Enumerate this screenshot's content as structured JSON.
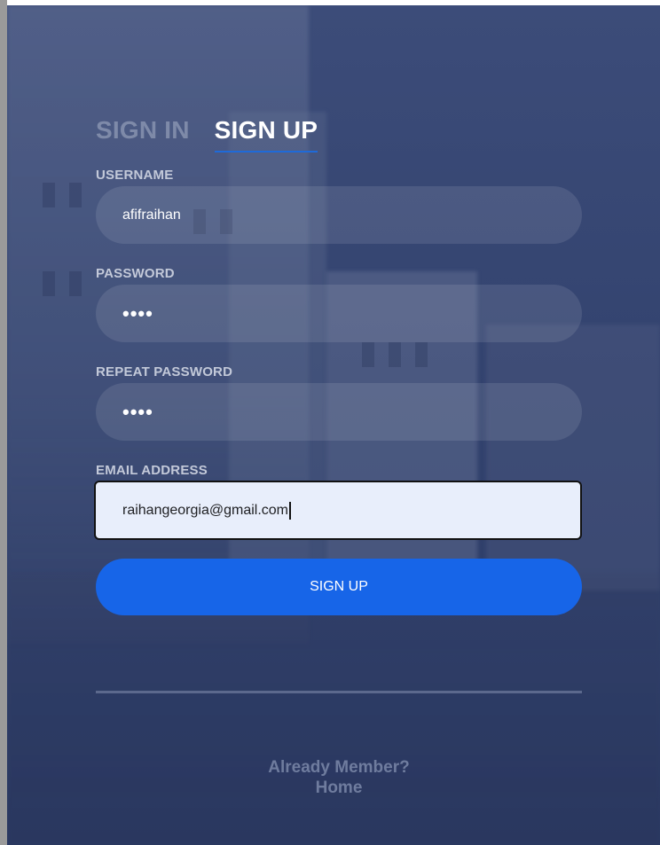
{
  "tabs": {
    "sign_in": "SIGN IN",
    "sign_up": "SIGN UP"
  },
  "form": {
    "username": {
      "label": "USERNAME",
      "value": "afifraihan"
    },
    "password": {
      "label": "PASSWORD",
      "value": "••••"
    },
    "repeat_password": {
      "label": "REPEAT PASSWORD",
      "value": "••••"
    },
    "email": {
      "label": "EMAIL ADDRESS",
      "value": "raihangeorgia@gmail.com"
    },
    "submit_label": "SIGN UP"
  },
  "footer": {
    "already_member": "Already Member?",
    "home_link": "Home"
  },
  "colors": {
    "background": "#33436f",
    "accent": "#1765e8",
    "active_tab_underline": "#1f6ad9"
  }
}
